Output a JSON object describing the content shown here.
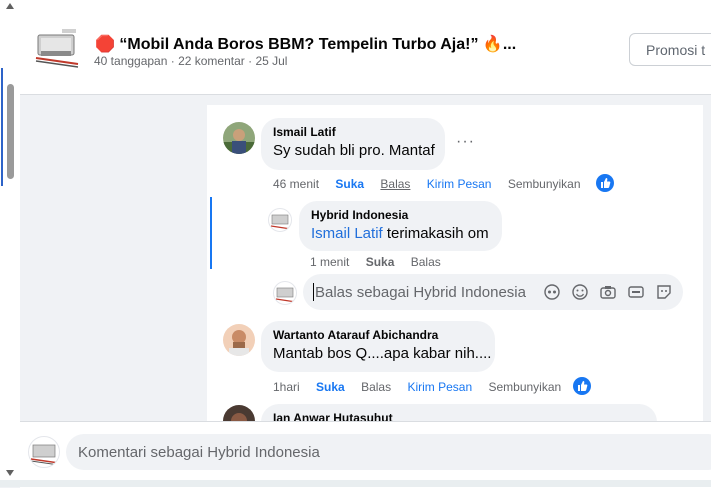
{
  "post": {
    "stop_emoji": "🛑",
    "title": "“Mobil Anda Boros BBM? Tempelin Turbo Aja!”",
    "fire_emoji": "🔥",
    "ellipsis": "...",
    "meta": "40 tanggapan · 22 komentar · 25 Jul",
    "promote_label": "Promosi t"
  },
  "comments": [
    {
      "author": "Ismail Latif",
      "text": "Sy sudah bli pro. Mantaf",
      "time": "46 menit",
      "like": "Suka",
      "reply": "Balas",
      "message": "Kirim Pesan",
      "hide": "Sembunyikan",
      "more": "···",
      "replies": [
        {
          "author": "Hybrid Indonesia",
          "mention": "Ismail Latif",
          "text": " terimakasih om",
          "time": "1 menit",
          "like": "Suka",
          "reply": "Balas"
        }
      ],
      "reply_box_placeholder": "Balas sebagai Hybrid Indonesia"
    },
    {
      "author": "Wartanto Atarauf Abichandra",
      "text": "Mantab bos Q....apa kabar nih....",
      "time": "1hari",
      "like": "Suka",
      "reply": "Balas",
      "message": "Kirim Pesan",
      "hide": "Sembunyikan"
    },
    {
      "author": "Ian Anwar Hutasuhut"
    }
  ],
  "composer": {
    "placeholder": "Komentari sebagai Hybrid Indonesia"
  },
  "colors": {
    "accent": "#1877f2",
    "bubble": "#f0f2f5",
    "muted": "#65676b"
  }
}
